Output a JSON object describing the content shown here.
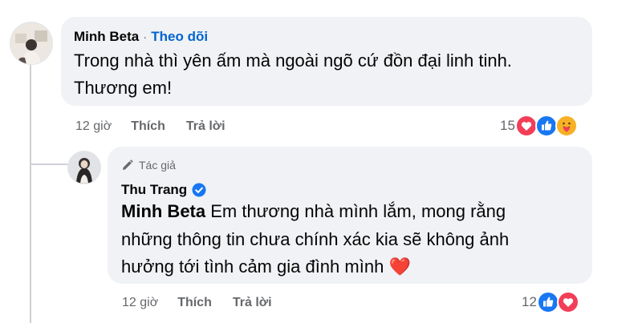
{
  "comment": {
    "author": "Minh Beta",
    "separator": "·",
    "follow_label": "Theo dõi",
    "text_line1": "Trong nhà thì yên ấm mà ngoài ngõ cứ đồn đại linh tinh.",
    "text_line2": "Thương em!",
    "time": "12 giờ",
    "like_label": "Thích",
    "reply_label": "Trả lời",
    "reaction_count": "15",
    "reactions": [
      "heart-icon",
      "like-icon",
      "care-icon"
    ]
  },
  "reply": {
    "author_badge": "Tác giả",
    "author": "Thu Trang",
    "mention": "Minh Beta",
    "text_line1_rest": " Em thương nhà mình lắm, mong rằng",
    "text_line2": "những thông tin chưa chính xác kia sẽ không ảnh",
    "text_line3": "hưởng tới tình cảm gia đình mình",
    "emoji": "❤️",
    "time": "12 giờ",
    "like_label": "Thích",
    "reply_label": "Trả lời",
    "reaction_count": "12",
    "reactions": [
      "like-icon",
      "heart-icon"
    ]
  },
  "colors": {
    "bubble_bg": "#f0f2f5",
    "follow_blue": "#0064d1",
    "like_blue": "#1877f2",
    "heart_red": "#f33e58",
    "care_yellow": "#f7b125",
    "muted_gray": "#65676b"
  }
}
